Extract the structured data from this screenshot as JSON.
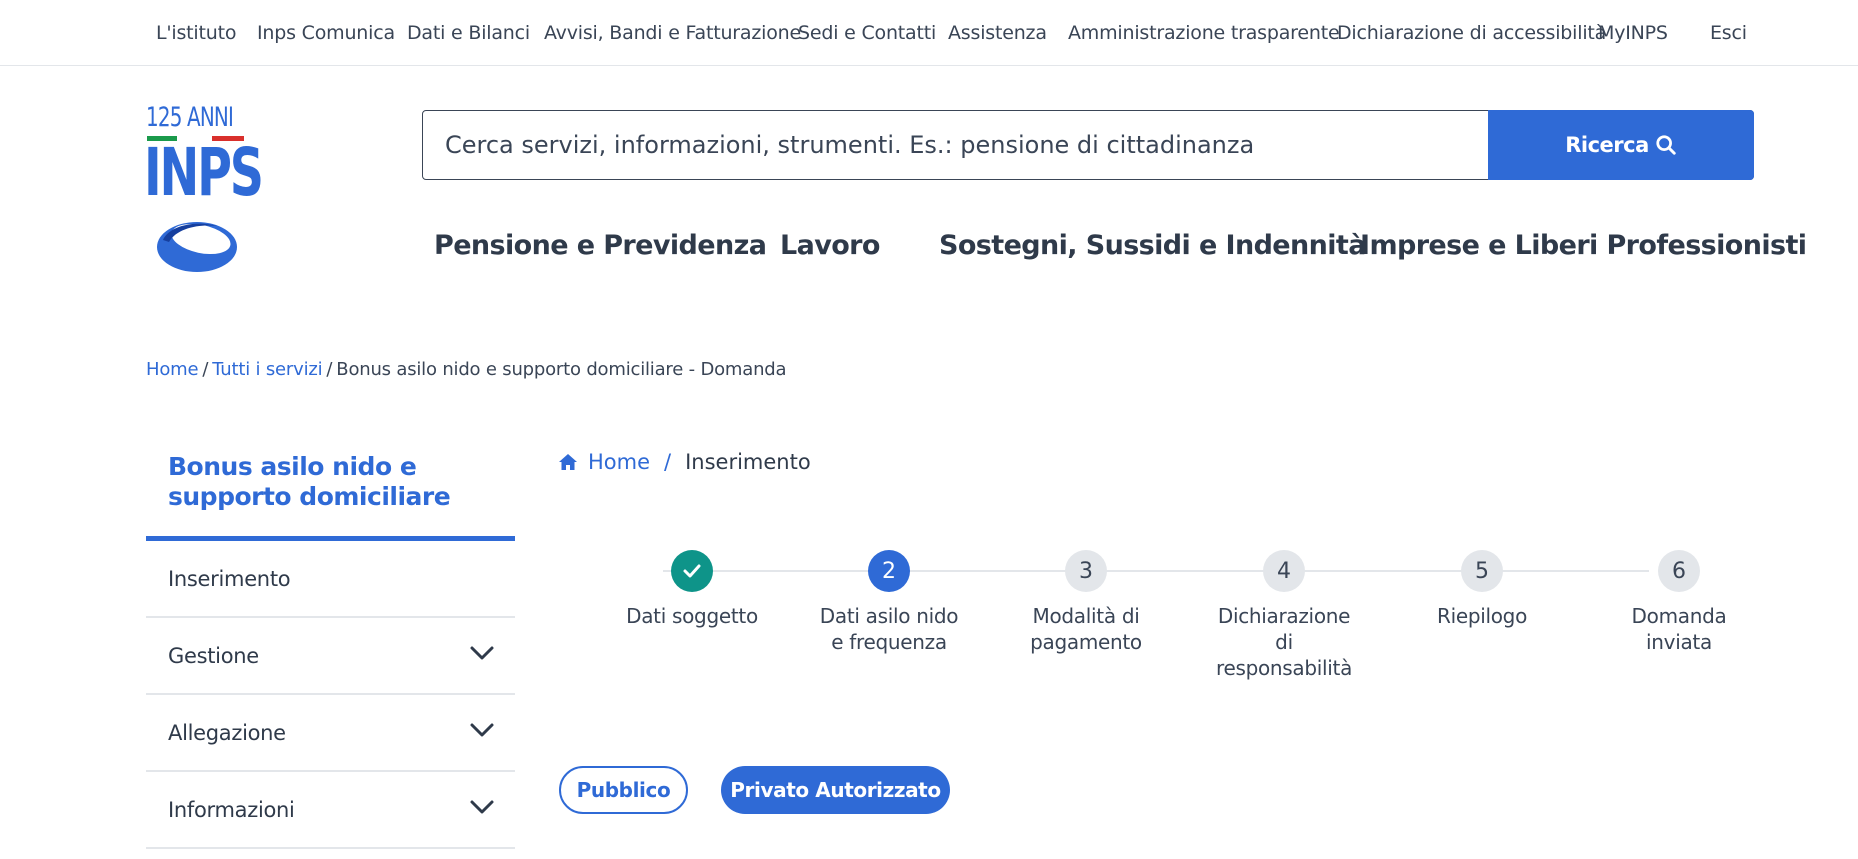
{
  "topnav": {
    "items": [
      "L'istituto",
      "Inps Comunica",
      "Dati e Bilanci",
      "Avvisi, Bandi e Fatturazione",
      "Sedi e Contatti",
      "Assistenza",
      "Amministrazione trasparente",
      "Dichiarazione di accessibilità",
      "MyINPS",
      "Esci"
    ]
  },
  "logo": {
    "anni": "125 ANNI",
    "brand": "INPS"
  },
  "search": {
    "placeholder": "Cerca servizi, informazioni, strumenti. Es.: pensione di cittadinanza",
    "button_label": "Ricerca"
  },
  "mainmenu": {
    "items": [
      "Pensione e Previdenza",
      "Lavoro",
      "Sostegni, Sussidi e Indennità",
      "Imprese e Liberi Professionisti"
    ]
  },
  "breadcrumb": {
    "home": "Home",
    "services": "Tutti i servizi",
    "current": "Bonus asilo nido e supporto domiciliare - Domanda"
  },
  "sidebar": {
    "title": "Bonus asilo nido e supporto domiciliare",
    "items": [
      {
        "label": "Inserimento"
      },
      {
        "label": "Gestione"
      },
      {
        "label": "Allegazione"
      },
      {
        "label": "Informazioni"
      }
    ]
  },
  "inner_breadcrumb": {
    "home": "Home",
    "current": "Inserimento"
  },
  "stepper": {
    "steps": [
      {
        "number": "1",
        "label_lines": [
          "Dati soggetto"
        ],
        "state": "done"
      },
      {
        "number": "2",
        "label_lines": [
          "Dati asilo nido",
          "e frequenza"
        ],
        "state": "active"
      },
      {
        "number": "3",
        "label_lines": [
          "Modalità di",
          "pagamento"
        ],
        "state": "todo"
      },
      {
        "number": "4",
        "label_lines": [
          "Dichiarazione",
          "di",
          "responsabilità"
        ],
        "state": "todo"
      },
      {
        "number": "5",
        "label_lines": [
          "Riepilogo"
        ],
        "state": "todo"
      },
      {
        "number": "6",
        "label_lines": [
          "Domanda",
          "inviata"
        ],
        "state": "todo"
      }
    ]
  },
  "buttons": {
    "pubblico": "Pubblico",
    "privato": "Privato Autorizzato"
  },
  "colors": {
    "accent": "#2f6ad6",
    "done": "#0e9489",
    "text": "#2f3a4a",
    "divider": "#e3e6ea"
  },
  "icons": [
    "search-icon",
    "home-icon",
    "check-icon",
    "chevron-down-icon",
    "inps-ring-logo"
  ]
}
